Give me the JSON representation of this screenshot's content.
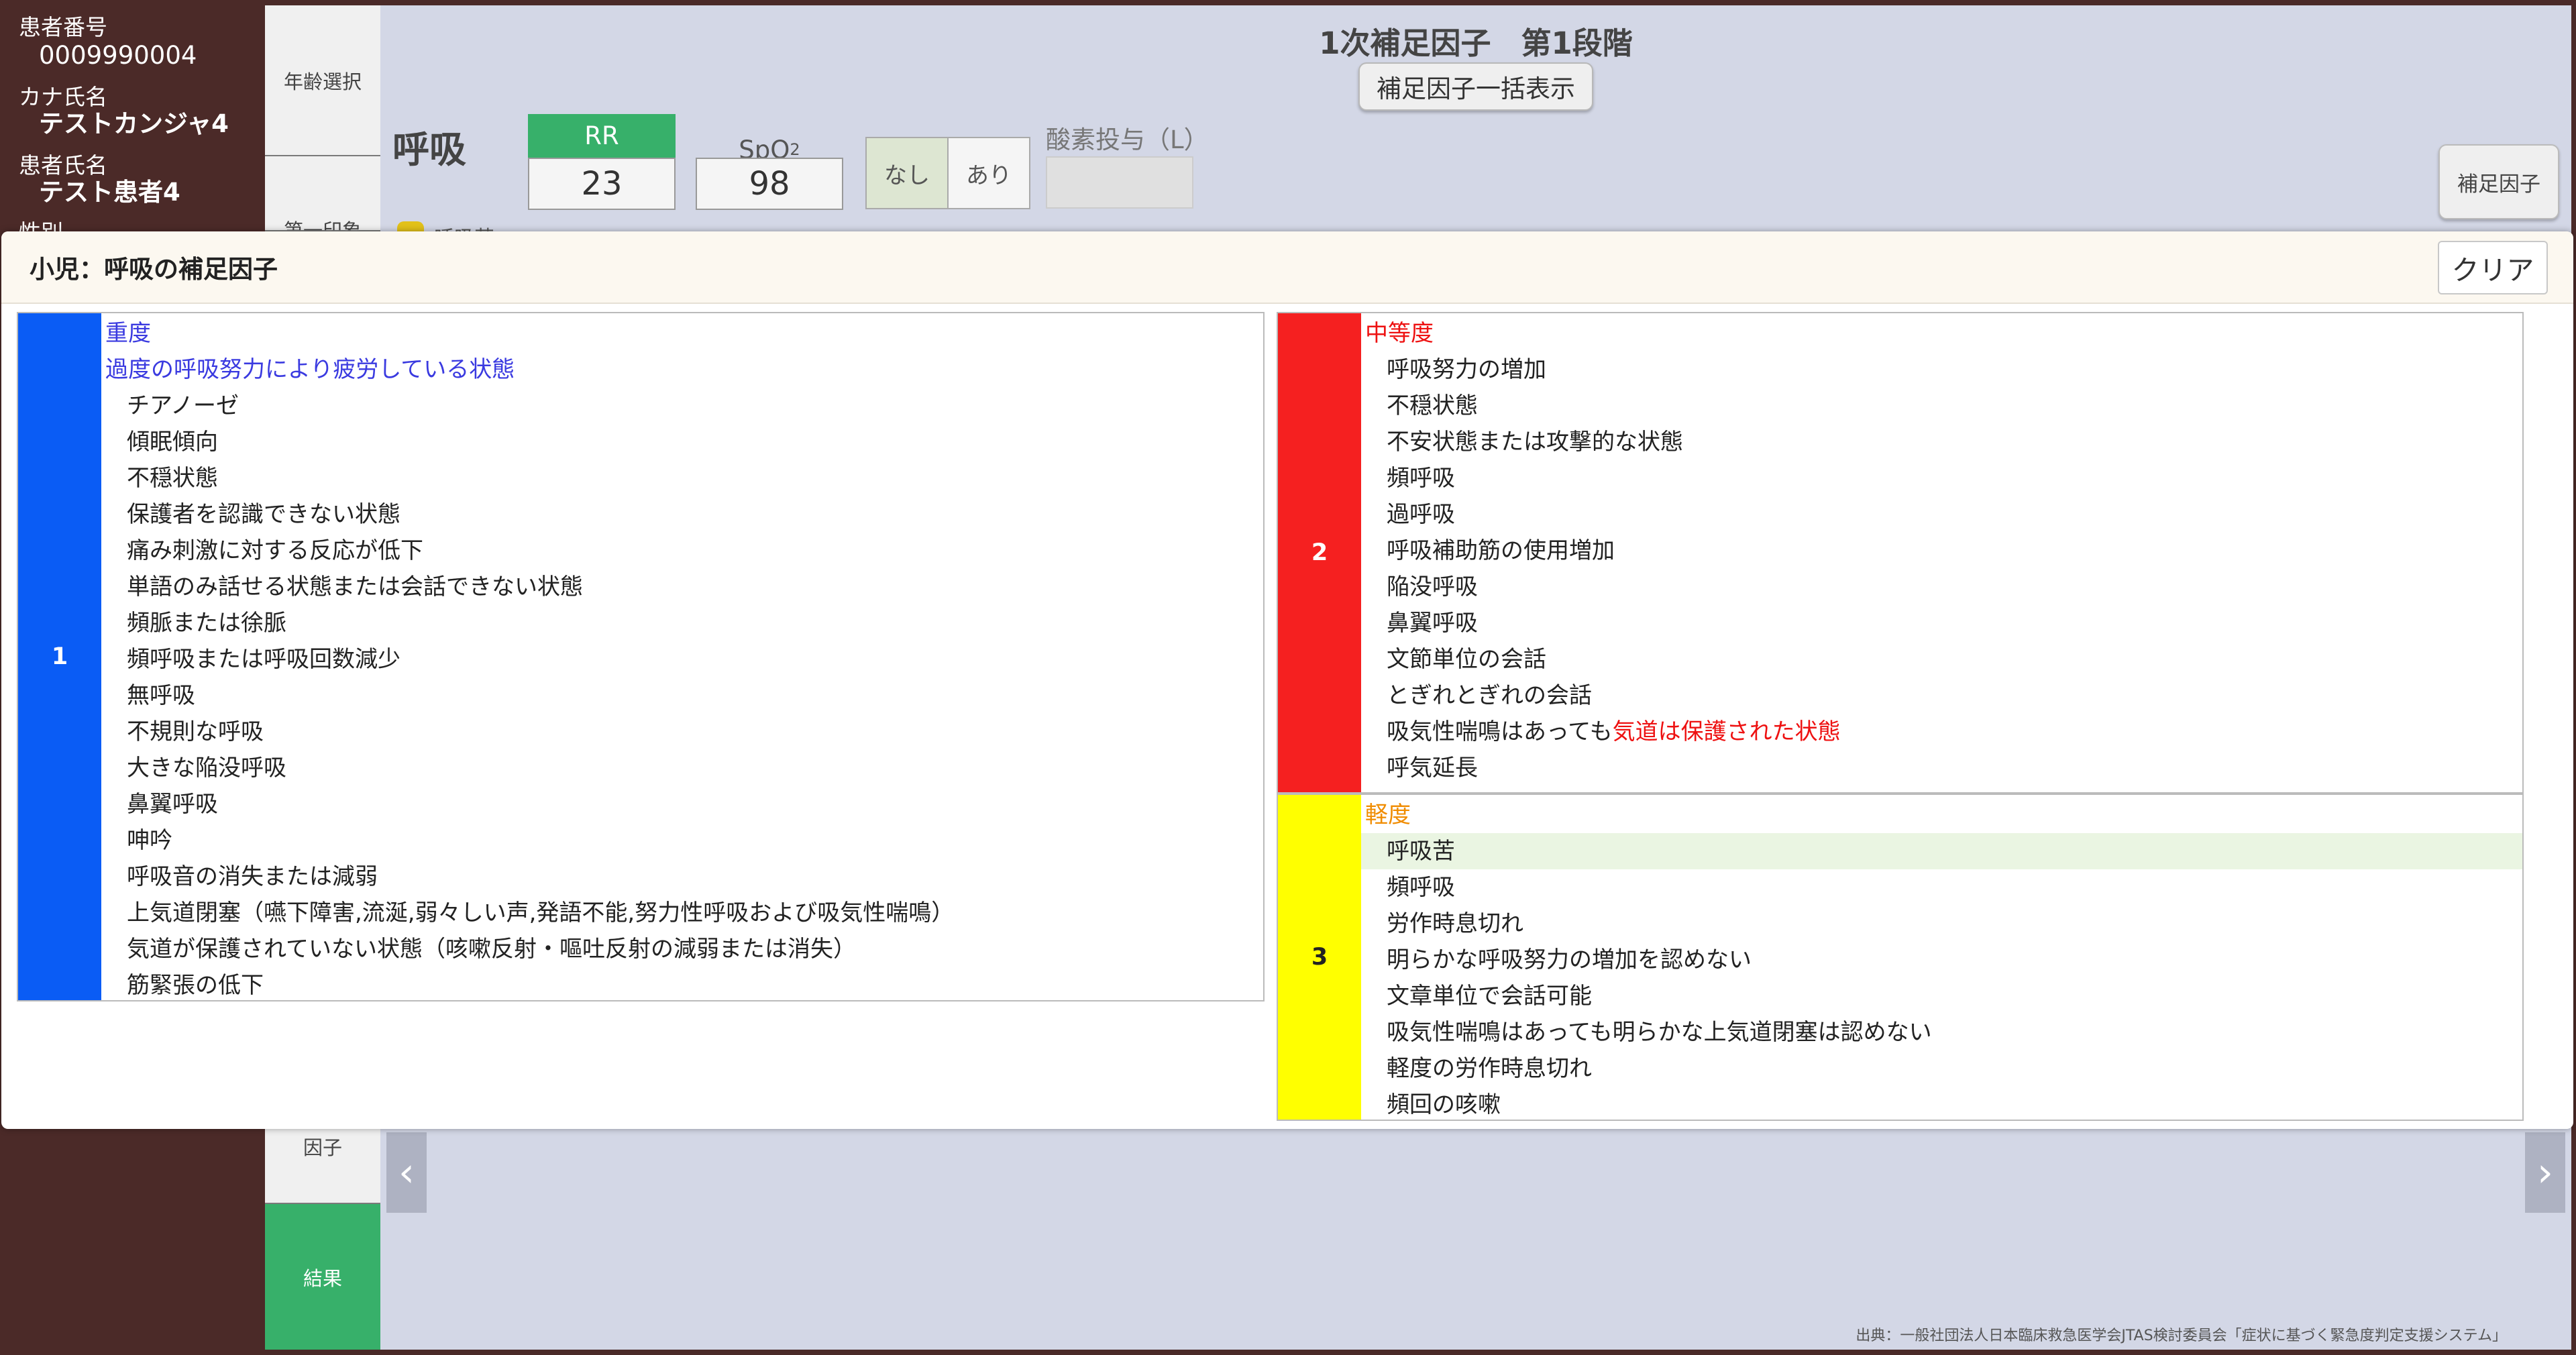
{
  "patient": {
    "id_label": "患者番号",
    "id_value": "0009990004",
    "kana_label": "カナ氏名",
    "kana_value": "テストカンジャ4",
    "name_label": "患者氏名",
    "name_value": "テスト患者4",
    "sex_label_partial": "性別"
  },
  "steps": {
    "age_select": "年齢選択",
    "first_impression": "第一印象",
    "factor": "因子",
    "result": "結果"
  },
  "header": {
    "title": "1次補足因子　第1段階",
    "bulk_button": "補足因子一括表示"
  },
  "vitals": {
    "section": "呼吸",
    "rr_label": "RR",
    "rr_value": "23",
    "spo2_label": "SpO",
    "spo2_sub": "2",
    "spo2_value": "98",
    "toggle_none": "なし",
    "toggle_yes": "あり",
    "oxygen_label": "酸素投与（L）",
    "oxygen_value": ""
  },
  "side_button": "補足因子",
  "behind_text": "呼吸苦",
  "source": "出典：一般社団法人日本臨床救急医学会JTAS検討委員会「症状に基づく緊急度判定支援システム」",
  "colors": {
    "level1": "#0a5cf5",
    "level2": "#f52020",
    "level3": "#ffff00",
    "result_green": "#37b06a",
    "sidebar": "#4b2a28"
  },
  "modal": {
    "title": "小児：呼吸の補足因子",
    "clear": "クリア",
    "group1": {
      "level": "1",
      "heading": "重度",
      "emphasis": "過度の呼吸努力により疲労している状態",
      "items": [
        "チアノーゼ",
        "傾眠傾向",
        "不穏状態",
        "保護者を認識できない状態",
        "痛み刺激に対する反応が低下",
        "単語のみ話せる状態または会話できない状態",
        "頻脈または徐脈",
        "頻呼吸または呼吸回数減少",
        "無呼吸",
        "不規則な呼吸",
        "大きな陥没呼吸",
        "鼻翼呼吸",
        "呻吟",
        "呼吸音の消失または減弱",
        "上気道閉塞（嚥下障害,流涎,弱々しい声,発語不能,努力性呼吸および吸気性喘鳴）",
        "気道が保護されていない状態（咳嗽反射・嘔吐反射の減弱または消失）",
        "筋緊張の低下"
      ]
    },
    "group2": {
      "level": "2",
      "heading": "中等度",
      "items": [
        "呼吸努力の増加",
        "不穏状態",
        "不安状態または攻撃的な状態",
        "頻呼吸",
        "過呼吸",
        "呼吸補助筋の使用増加",
        "陥没呼吸",
        "鼻翼呼吸",
        "文節単位の会話",
        "とぎれとぎれの会話"
      ],
      "wheeze_prefix": "吸気性喘鳴はあっても",
      "wheeze_accent": "気道は保護された状態",
      "last_item": "呼気延長"
    },
    "group3": {
      "level": "3",
      "heading": "軽度",
      "items": [
        "呼吸苦",
        "頻呼吸",
        "労作時息切れ",
        "明らかな呼吸努力の増加を認めない",
        "文章単位で会話可能",
        "吸気性喘鳴はあっても明らかな上気道閉塞は認めない",
        "軽度の労作時息切れ",
        "頻回の咳嗽"
      ]
    }
  }
}
